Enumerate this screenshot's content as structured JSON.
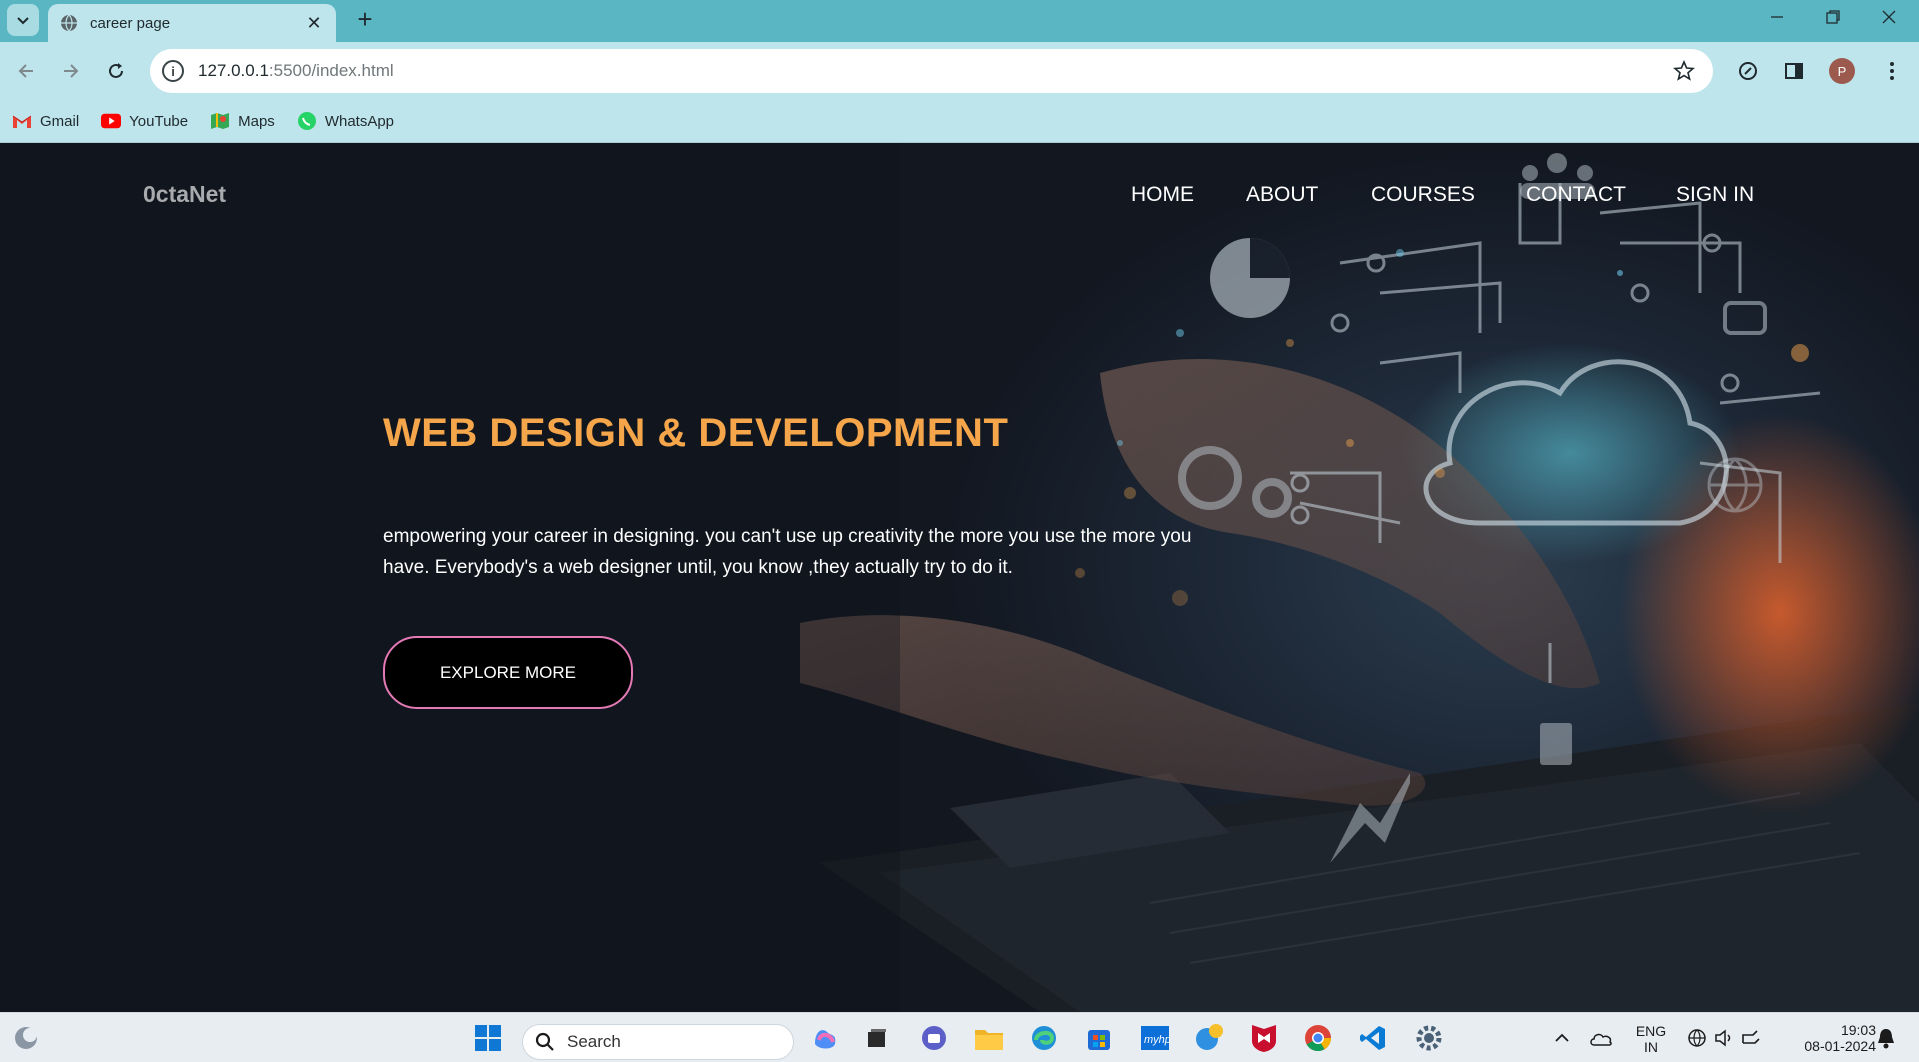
{
  "browser": {
    "tab": {
      "title": "career page"
    },
    "address": {
      "host": "127.0.0.1",
      "path": ":5500/index.html"
    },
    "profile_initial": "P",
    "bookmarks": [
      {
        "label": "Gmail",
        "icon": "gmail-icon"
      },
      {
        "label": "YouTube",
        "icon": "youtube-icon"
      },
      {
        "label": "Maps",
        "icon": "maps-icon"
      },
      {
        "label": "WhatsApp",
        "icon": "whatsapp-icon"
      }
    ]
  },
  "site": {
    "brand": "0ctaNet",
    "nav": [
      "HOME",
      "ABOUT",
      "COURSES",
      "CONTACT",
      "SIGN IN"
    ],
    "headline": "WEB DESIGN & DEVELOPMENT",
    "lede": "empowering your career in designing. you can't use up creativity the more you use the more you have. Everybody's a web designer until, you know ,they actually try to do it.",
    "cta": "EXPLORE MORE"
  },
  "taskbar": {
    "search_label": "Search",
    "lang_top": "ENG",
    "lang_bottom": "IN",
    "time": "19:03",
    "date": "08-01-2024"
  },
  "colors": {
    "tabstrip": "#5bb6c4",
    "toolbar": "#bfe5ec",
    "headline": "#f5a54a",
    "cta_border": "#e37ab6",
    "page_bg": "#11151c"
  }
}
